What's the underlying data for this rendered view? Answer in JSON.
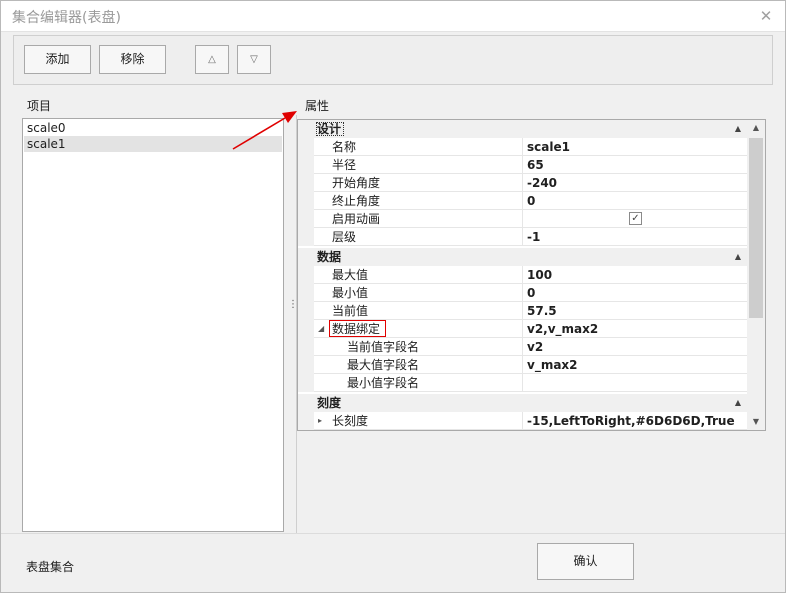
{
  "window": {
    "title": "集合编辑器(表盘)",
    "close_glyph": "✕"
  },
  "toolbar": {
    "add_label": "添加",
    "remove_label": "移除",
    "up_glyph": "△",
    "down_glyph": "▽"
  },
  "items_panel": {
    "label": "项目",
    "items": [
      "scale0",
      "scale1"
    ],
    "selected_index": 1
  },
  "props_panel": {
    "label": "属性",
    "categories": [
      {
        "name": "设计",
        "rows": [
          {
            "name": "名称",
            "value": "scale1"
          },
          {
            "name": "半径",
            "value": "65"
          },
          {
            "name": "开始角度",
            "value": "-240"
          },
          {
            "name": "终止角度",
            "value": "0"
          },
          {
            "name": "启用动画",
            "value": "",
            "check_glyph": "✓"
          },
          {
            "name": "层级",
            "value": "-1"
          }
        ]
      },
      {
        "name": "数据",
        "rows": [
          {
            "name": "最大值",
            "value": "100"
          },
          {
            "name": "最小值",
            "value": "0"
          },
          {
            "name": "当前值",
            "value": "57.5"
          },
          {
            "name": "数据绑定",
            "value": "v2,v_max2",
            "expander": "◢"
          },
          {
            "name": "当前值字段名",
            "value": "v2"
          },
          {
            "name": "最大值字段名",
            "value": "v_max2"
          },
          {
            "name": "最小值字段名",
            "value": ""
          }
        ]
      },
      {
        "name": "刻度",
        "rows": [
          {
            "name": "长刻度",
            "value": "-15,LeftToRight,#6D6D6D,True",
            "expander": "▸"
          }
        ]
      }
    ],
    "collapse_glyph": "▲",
    "scroll_up_glyph": "▲",
    "scroll_down_glyph": "▼",
    "splitter_glyph": "⋮"
  },
  "footer": {
    "label": "表盘集合",
    "ok_label": "确认"
  },
  "colors": {
    "annotation_red": "#e00000"
  }
}
